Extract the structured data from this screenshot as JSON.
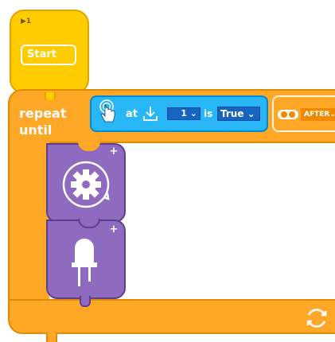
{
  "start_block": {
    "flag_label": "▶1",
    "start_label": "Start"
  },
  "repeat_block": {
    "label": "repeat\nuntil"
  },
  "condition": {
    "at_label": "at",
    "number_value": "1",
    "is_label": "is",
    "bool_value": "True"
  },
  "after_block": {
    "value": "AFTER"
  },
  "colors": {
    "start": "#ffcc00",
    "repeat": "#ffa726",
    "condition": "#29b6f6",
    "action": "#8e6bbf"
  },
  "icons": [
    "touch-sensor-icon",
    "download-arrow-icon",
    "after-toggle-icon",
    "gear-rotate-icon",
    "led-icon",
    "loop-icon",
    "add-icon"
  ]
}
